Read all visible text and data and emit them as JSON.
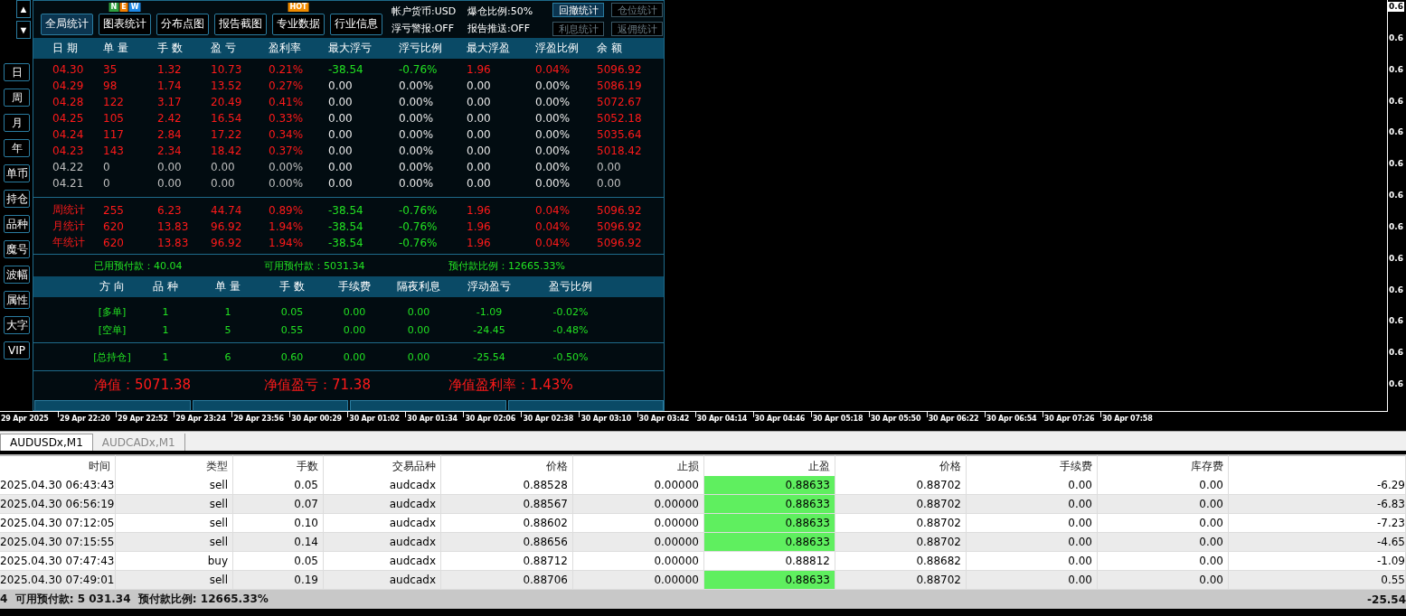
{
  "side_nav": {
    "arrows": [
      "▲",
      "▼"
    ],
    "buttons": [
      "日",
      "周",
      "月",
      "年",
      "单币",
      "持仓",
      "品种",
      "魔号",
      "波幅",
      "属性",
      "大字",
      "VIP"
    ]
  },
  "panel": {
    "toolbar": [
      {
        "label": "全局统计",
        "selected": true
      },
      {
        "label": "图表统计",
        "selected": false,
        "badges": [
          {
            "text": "N",
            "color": "#2e9e3e"
          },
          {
            "text": "E",
            "color": "#f07d00"
          },
          {
            "text": "W",
            "color": "#1e88e5"
          }
        ]
      },
      {
        "label": "分布点图",
        "selected": false
      },
      {
        "label": "报告截图",
        "selected": false
      },
      {
        "label": "专业数据",
        "selected": false,
        "badges": [
          {
            "text": "HOT",
            "color": "#f08c00"
          }
        ]
      },
      {
        "label": "行业信息",
        "selected": false
      }
    ],
    "info": [
      "帐户货币:USD",
      "爆仓比例:50%",
      "浮亏警报:OFF",
      "报告推送:OFF"
    ],
    "stat_buttons": [
      {
        "label": "回撤统计",
        "disabled": false
      },
      {
        "label": "仓位统计",
        "disabled": true
      },
      {
        "label": "利息统计",
        "disabled": true
      },
      {
        "label": "返佣统计",
        "disabled": true
      }
    ],
    "stats_columns": [
      "日 期",
      "单 量",
      "手 数",
      "盈 亏",
      "盈利率",
      "最大浮亏",
      "浮亏比例",
      "最大浮盈",
      "浮盈比例",
      "余 额"
    ],
    "daily_rows": [
      {
        "cells": [
          "04.30",
          "35",
          "1.32",
          "10.73",
          "0.21%",
          "-38.54",
          "-0.76%",
          "1.96",
          "0.04%",
          "5096.92"
        ],
        "active": true,
        "drawdown": true
      },
      {
        "cells": [
          "04.29",
          "98",
          "1.74",
          "13.52",
          "0.27%",
          "0.00",
          "0.00%",
          "0.00",
          "0.00%",
          "5086.19"
        ],
        "active": true,
        "drawdown": false
      },
      {
        "cells": [
          "04.28",
          "122",
          "3.17",
          "20.49",
          "0.41%",
          "0.00",
          "0.00%",
          "0.00",
          "0.00%",
          "5072.67"
        ],
        "active": true,
        "drawdown": false
      },
      {
        "cells": [
          "04.25",
          "105",
          "2.42",
          "16.54",
          "0.33%",
          "0.00",
          "0.00%",
          "0.00",
          "0.00%",
          "5052.18"
        ],
        "active": true,
        "drawdown": false
      },
      {
        "cells": [
          "04.24",
          "117",
          "2.84",
          "17.22",
          "0.34%",
          "0.00",
          "0.00%",
          "0.00",
          "0.00%",
          "5035.64"
        ],
        "active": true,
        "drawdown": false
      },
      {
        "cells": [
          "04.23",
          "143",
          "2.34",
          "18.42",
          "0.37%",
          "0.00",
          "0.00%",
          "0.00",
          "0.00%",
          "5018.42"
        ],
        "active": true,
        "drawdown": false
      },
      {
        "cells": [
          "04.22",
          "0",
          "0.00",
          "0.00",
          "0.00%",
          "0.00",
          "0.00%",
          "0.00",
          "0.00%",
          "0.00"
        ],
        "active": false,
        "drawdown": false
      },
      {
        "cells": [
          "04.21",
          "0",
          "0.00",
          "0.00",
          "0.00%",
          "0.00",
          "0.00%",
          "0.00",
          "0.00%",
          "0.00"
        ],
        "active": false,
        "drawdown": false
      }
    ],
    "summary_rows": [
      {
        "cells": [
          "周统计",
          "255",
          "6.23",
          "44.74",
          "0.89%",
          "-38.54",
          "-0.76%",
          "1.96",
          "0.04%",
          "5096.92"
        ],
        "active": true,
        "drawdown": true
      },
      {
        "cells": [
          "月统计",
          "620",
          "13.83",
          "96.92",
          "1.94%",
          "-38.54",
          "-0.76%",
          "1.96",
          "0.04%",
          "5096.92"
        ],
        "active": true,
        "drawdown": true
      },
      {
        "cells": [
          "年统计",
          "620",
          "13.83",
          "96.92",
          "1.94%",
          "-38.54",
          "-0.76%",
          "1.96",
          "0.04%",
          "5096.92"
        ],
        "active": true,
        "drawdown": true
      }
    ],
    "margin": [
      "已用预付款：40.04",
      "可用预付款：5031.34",
      "预付款比例：12665.33%"
    ],
    "position_columns": [
      "方 向",
      "品 种",
      "单 量",
      "手 数",
      "手续费",
      "隔夜利息",
      "浮动盈亏",
      "盈亏比例"
    ],
    "positions": [
      [
        "[多单]",
        "1",
        "1",
        "0.05",
        "0.00",
        "0.00",
        "-1.09",
        "-0.02%"
      ],
      [
        "[空单]",
        "1",
        "5",
        "0.55",
        "0.00",
        "0.00",
        "-24.45",
        "-0.48%"
      ]
    ],
    "position_total": [
      "[总持仓]",
      "1",
      "6",
      "0.60",
      "0.00",
      "0.00",
      "-25.54",
      "-0.50%"
    ],
    "equity": [
      "净值：5071.38",
      "净值盈亏：71.38",
      "净值盈利率：1.43%"
    ]
  },
  "price_axis": {
    "labels": [
      {
        "text": "0.6",
        "current": true
      },
      {
        "text": "0.6",
        "current": false
      },
      {
        "text": "0.6",
        "current": false
      },
      {
        "text": "0.6",
        "current": false
      },
      {
        "text": "0.6",
        "current": false
      },
      {
        "text": "0.6",
        "current": false
      },
      {
        "text": "0.6",
        "current": false
      },
      {
        "text": "0.6",
        "current": false
      },
      {
        "text": "0.6",
        "current": false
      },
      {
        "text": "0.6",
        "current": false
      },
      {
        "text": "0.6",
        "current": false
      },
      {
        "text": "0.6",
        "current": false
      },
      {
        "text": "0.6",
        "current": false
      }
    ]
  },
  "time_axis": [
    "29 Apr 2025",
    "29 Apr 22:20",
    "29 Apr 22:52",
    "29 Apr 23:24",
    "29 Apr 23:56",
    "30 Apr 00:29",
    "30 Apr 01:02",
    "30 Apr 01:34",
    "30 Apr 02:06",
    "30 Apr 02:38",
    "30 Apr 03:10",
    "30 Apr 03:42",
    "30 Apr 04:14",
    "30 Apr 04:46",
    "30 Apr 05:18",
    "30 Apr 05:50",
    "30 Apr 06:22",
    "30 Apr 06:54",
    "30 Apr 07:26",
    "30 Apr 07:58"
  ],
  "chart_tabs": [
    {
      "label": "AUDUSDx,M1",
      "selected": true
    },
    {
      "label": "AUDCADx,M1",
      "selected": false
    }
  ],
  "orders": {
    "columns": [
      "时间",
      "类型",
      "手数",
      "交易品种",
      "价格",
      "止损",
      "止盈",
      "价格",
      "手续费",
      "库存费"
    ],
    "rows": [
      {
        "cells": [
          "2025.04.30 06:43:43",
          "sell",
          "0.05",
          "audcadx",
          "0.88528",
          "0.00000",
          "0.88633",
          "0.88702",
          "0.00",
          "0.00",
          "-6.29"
        ],
        "tp_highlight": true
      },
      {
        "cells": [
          "2025.04.30 06:56:19",
          "sell",
          "0.07",
          "audcadx",
          "0.88567",
          "0.00000",
          "0.88633",
          "0.88702",
          "0.00",
          "0.00",
          "-6.83"
        ],
        "tp_highlight": true
      },
      {
        "cells": [
          "2025.04.30 07:12:05",
          "sell",
          "0.10",
          "audcadx",
          "0.88602",
          "0.00000",
          "0.88633",
          "0.88702",
          "0.00",
          "0.00",
          "-7.23"
        ],
        "tp_highlight": true
      },
      {
        "cells": [
          "2025.04.30 07:15:55",
          "sell",
          "0.14",
          "audcadx",
          "0.88656",
          "0.00000",
          "0.88633",
          "0.88702",
          "0.00",
          "0.00",
          "-4.65"
        ],
        "tp_highlight": true
      },
      {
        "cells": [
          "2025.04.30 07:47:43",
          "buy",
          "0.05",
          "audcadx",
          "0.88712",
          "0.00000",
          "0.88812",
          "0.88682",
          "0.00",
          "0.00",
          "-1.09"
        ],
        "tp_highlight": false
      },
      {
        "cells": [
          "2025.04.30 07:49:01",
          "sell",
          "0.19",
          "audcadx",
          "0.88706",
          "0.00000",
          "0.88633",
          "0.88702",
          "0.00",
          "0.00",
          "0.55"
        ],
        "tp_highlight": true
      }
    ],
    "footer": "4  可用预付款: 5 031.34  预付款比例: 12665.33%",
    "footer_total": "-25.54"
  }
}
